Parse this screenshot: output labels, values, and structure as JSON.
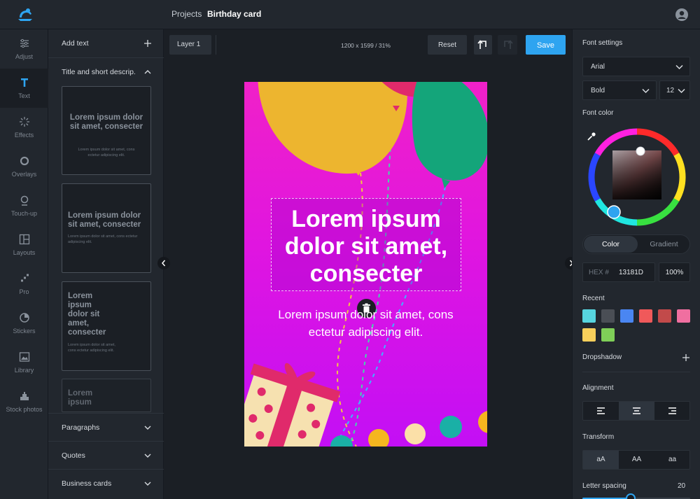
{
  "header": {
    "breadcrumb_projects": "Projects",
    "breadcrumb_current": "Birthday card",
    "logo_icon": "frog-logo-icon",
    "user_icon": "user-avatar-icon"
  },
  "nav": {
    "items": [
      {
        "label": "Adjust",
        "icon": "sliders-icon"
      },
      {
        "label": "Text",
        "icon": "text-icon"
      },
      {
        "label": "Effects",
        "icon": "sparkle-icon"
      },
      {
        "label": "Overlays",
        "icon": "ring-icon"
      },
      {
        "label": "Touch-up",
        "icon": "face-icon"
      },
      {
        "label": "Layouts",
        "icon": "layout-icon"
      },
      {
        "label": "Pro",
        "icon": "pro-icon"
      },
      {
        "label": "Stickers",
        "icon": "sticker-icon"
      },
      {
        "label": "Library",
        "icon": "image-icon"
      },
      {
        "label": "Stock photos",
        "icon": "stock-icon"
      }
    ]
  },
  "panel": {
    "add_text": "Add text",
    "section_title": "Title and short descrip.",
    "templates": [
      {
        "heading": "Lorem ipsum dolor sit amet, consecter",
        "body": "Lorem ipsum dolor sit amet, cons ectetur adipiscing elit."
      },
      {
        "heading": "Lorem ipsum dolor sit amet, consecter",
        "body": "Lorem ipsum dolor sit amet, cons ectetur adipiscing elit."
      },
      {
        "heading": "Lorem ipsum dolor sit amet, consecter",
        "body": "Lorem ipsum dolor sit amet, cons ectetur adipiscing elit."
      },
      {
        "heading": "Lorem ipsum",
        "body": ""
      }
    ],
    "sections": [
      "Paragraphs",
      "Quotes",
      "Business cards"
    ]
  },
  "toolbar": {
    "layer": "Layer 1",
    "dimensions": "1200 x 1599 / 31%",
    "reset": "Reset",
    "save": "Save"
  },
  "canvas": {
    "heading": "Lorem ipsum dolor sit amet, consecter",
    "subtext": "Lorem ipsum dolor sit amet, cons ectetur adipiscing elit."
  },
  "settings": {
    "font_settings": "Font settings",
    "font_family": "Arial",
    "font_weight": "Bold",
    "font_size": "12",
    "font_color": "Font color",
    "tab_color": "Color",
    "tab_gradient": "Gradient",
    "hex_label": "HEX #",
    "hex_value": "13181D",
    "opacity": "100%",
    "recent": "Recent",
    "recent_colors": [
      "#57d5df",
      "#4a4e55",
      "#4a86f2",
      "#f0595a",
      "#c24a4a",
      "#f06fa0",
      "#f7cf5b",
      "#7fcf58"
    ],
    "dropshadow": "Dropshadow",
    "alignment": "Alignment",
    "transform": "Transform",
    "transform_options": [
      "aA",
      "AA",
      "aa"
    ],
    "letter_spacing": "Letter spacing",
    "letter_spacing_value": "20"
  },
  "colors": {
    "accent": "#2ea4f0",
    "card_top": "#f021c8",
    "card_bottom": "#c30ff5"
  }
}
